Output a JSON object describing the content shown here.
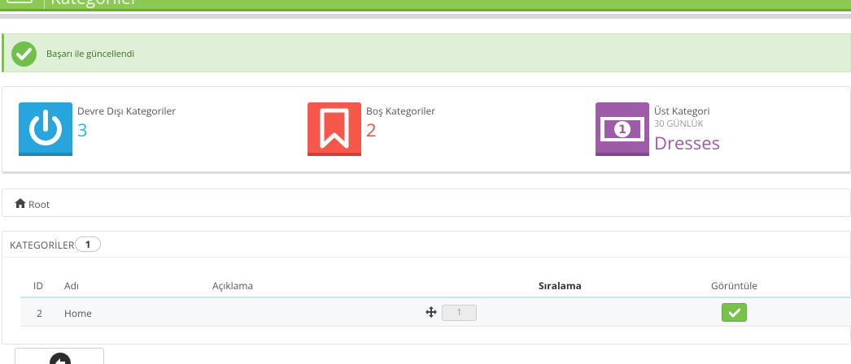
{
  "header": {
    "title": "Kategoriler"
  },
  "alert": {
    "message": "Başarı ile güncellendi",
    "icon": "check-circle-icon"
  },
  "kpis": [
    {
      "label": "Devre Dışı Kategoriler",
      "value": "3",
      "color": "#25b9d7",
      "tile_color": "#28a5dc",
      "icon": "power-icon"
    },
    {
      "label": "Boş Kategoriler",
      "value": "2",
      "color": "#f54c3e",
      "tile_color": "#f5574b",
      "icon": "bookmark-icon"
    },
    {
      "label": "Üst Kategori",
      "sublabel": "30 GÜNLÜK",
      "value": "Dresses",
      "color": "#a05aa5",
      "tile_color": "#9e5ba7",
      "icon": "banknote-icon"
    }
  ],
  "breadcrumb": {
    "icon": "home-icon",
    "label": "Root"
  },
  "categories": {
    "title": "KATEGORİLER",
    "count": "1",
    "columns": [
      "ID",
      "Adı",
      "Açıklama",
      "Sıralama",
      "Görüntüle"
    ],
    "rows": [
      {
        "id": "2",
        "name": "Home",
        "description": "",
        "position": "1",
        "displayed": true
      }
    ]
  },
  "colors": {
    "header_green": "#8bc954",
    "success_bg": "#e0efd7",
    "success_text": "#3b6e22",
    "enabled_green": "#78c24a"
  }
}
